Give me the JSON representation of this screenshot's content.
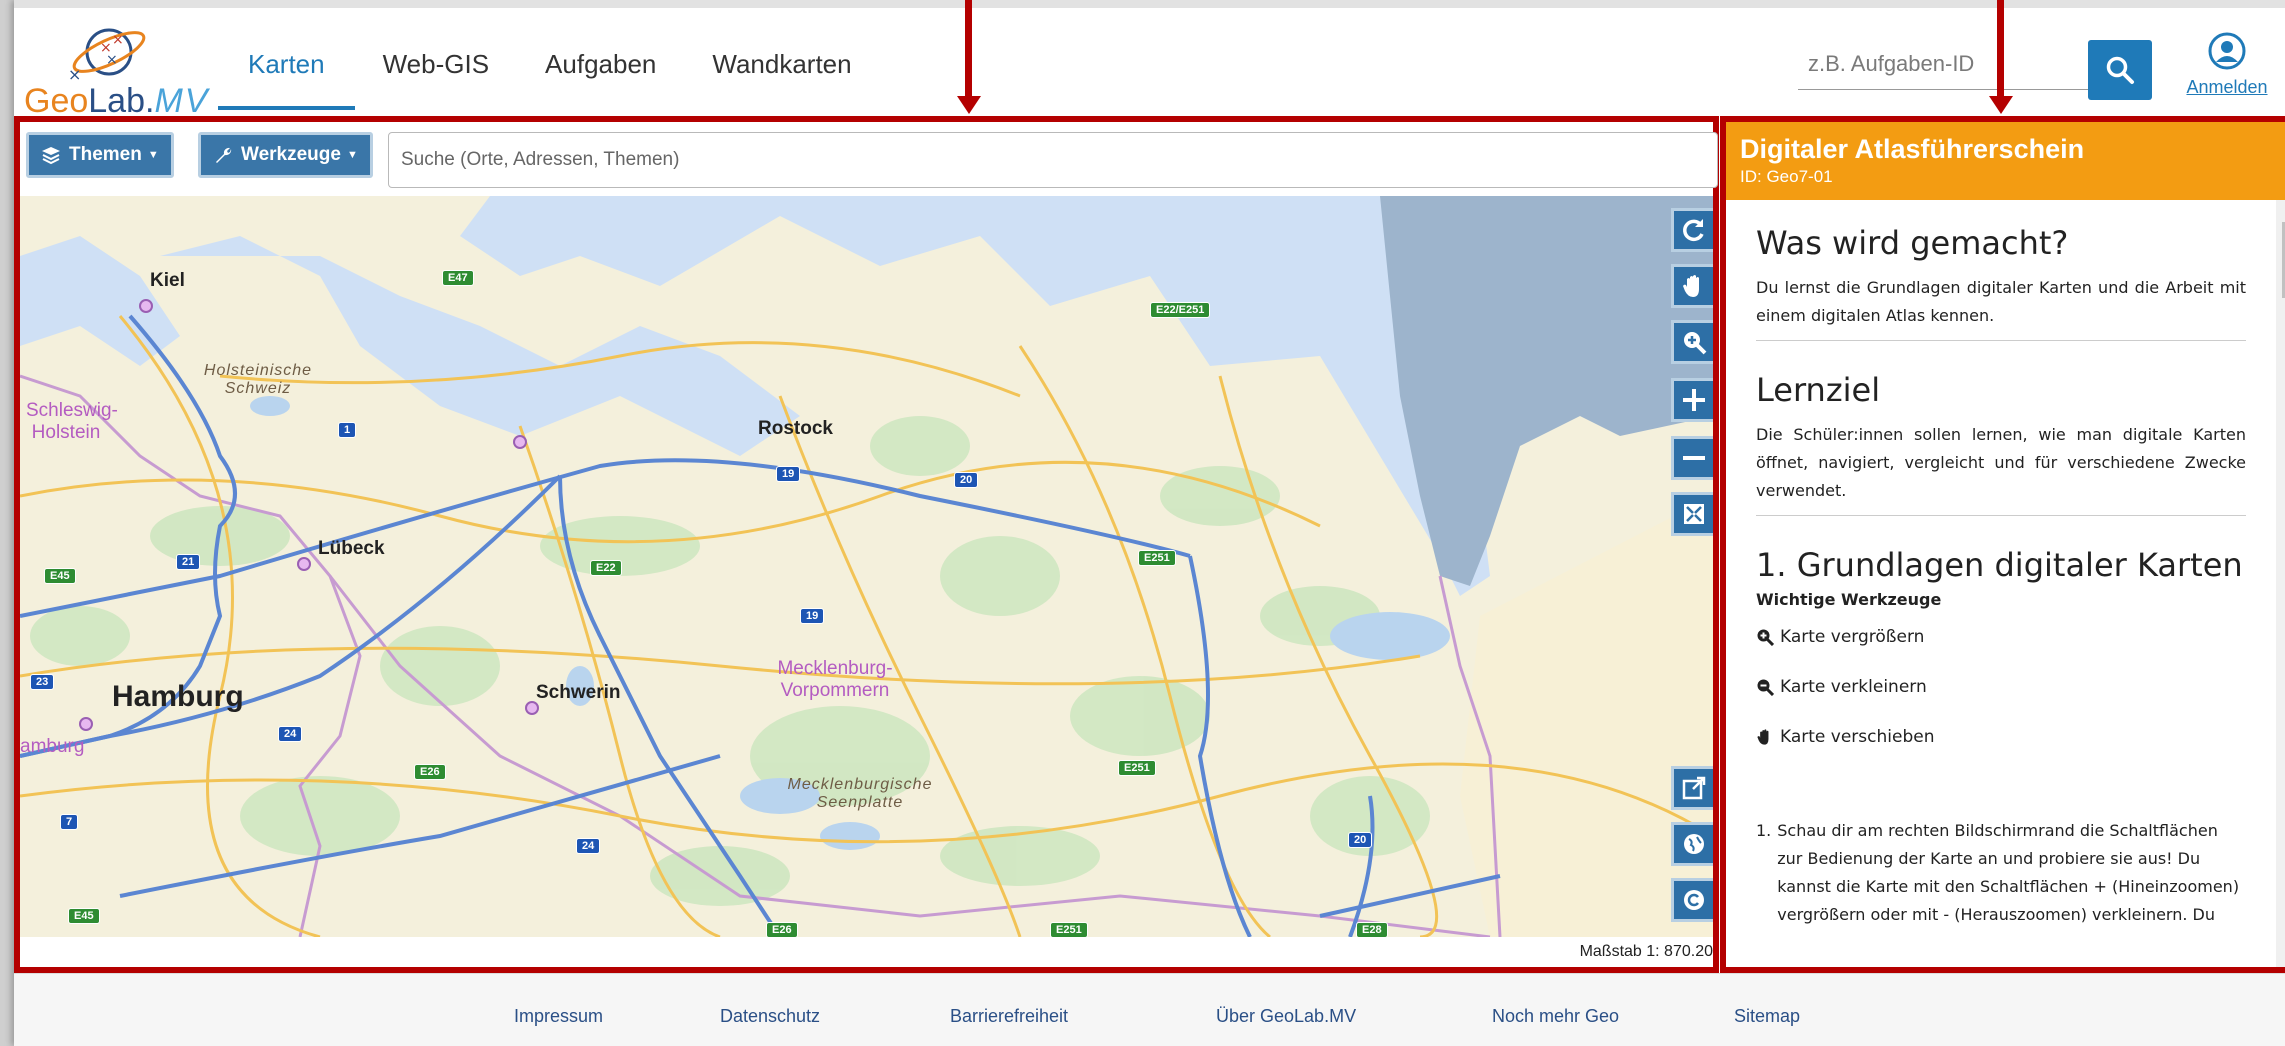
{
  "header": {
    "logo": {
      "geo": "Geo",
      "lab": "Lab.",
      "mv": "MV"
    },
    "nav": [
      {
        "label": "Karten"
      },
      {
        "label": "Web-GIS"
      },
      {
        "label": "Aufgaben"
      },
      {
        "label": "Wandkarten"
      }
    ],
    "search": {
      "placeholder": "z.B. Aufgaben-ID"
    },
    "login_label": "Anmelden"
  },
  "map": {
    "themes_label": "Themen",
    "tools_label": "Werkzeuge",
    "search_placeholder": "Suche (Orte, Adressen, Themen)",
    "scale_text": "Maßstab 1: 870.20",
    "places": [
      "Kiel",
      "Rostock",
      "Lübeck",
      "Hamburg",
      "Schwerin"
    ],
    "regions": [
      "Schleswig-Holstein",
      "Mecklenburg-Vorpommern"
    ],
    "areas": [
      "Holsteinische Schweiz",
      "Mecklenburgische Seenplatte"
    ],
    "shields": [
      "E47",
      "E22/E251",
      "1",
      "19",
      "20",
      "21",
      "E45",
      "E22",
      "E251",
      "19",
      "23",
      "24",
      "E26",
      "7",
      "24",
      "E251",
      "20",
      "E45",
      "E26",
      "E251",
      "E28",
      "amburg"
    ],
    "accent": "#b40000"
  },
  "panel": {
    "title": "Digitaler Atlasführerschein",
    "id_text": "ID: Geo7-01",
    "s1_heading": "Was wird gemacht?",
    "s1_text": "Du lernst die Grundlagen digitaler Karten und die Arbeit mit einem digitalen Atlas kennen.",
    "s2_heading": "Lernziel",
    "s2_text": "Die Schüler:innen sollen lernen, wie man digitale Karten öffnet, navigiert, vergleicht und für verschiedene Zwecke verwendet.",
    "s3_heading": "1. Grundlagen digitaler Karten",
    "s3_sub": "Wichtige Werkzeuge",
    "tools": [
      "Karte vergrößern",
      "Karte verkleinern",
      "Karte verschieben"
    ],
    "task_text": "Schau dir am rechten Bildschirmrand die Schaltflächen zur Bedienung der Karte an und probiere sie aus! Du kannst die Karte mit den Schaltflächen + (Hineinzoomen) vergrößern oder mit - (Herauszoomen) verkleinern. Du",
    "header_color": "#f39c12"
  },
  "footer": {
    "links": [
      "Impressum",
      "Datenschutz",
      "Barrierefreiheit",
      "Über GeoLab.MV",
      "Noch mehr Geo",
      "Sitemap"
    ]
  }
}
